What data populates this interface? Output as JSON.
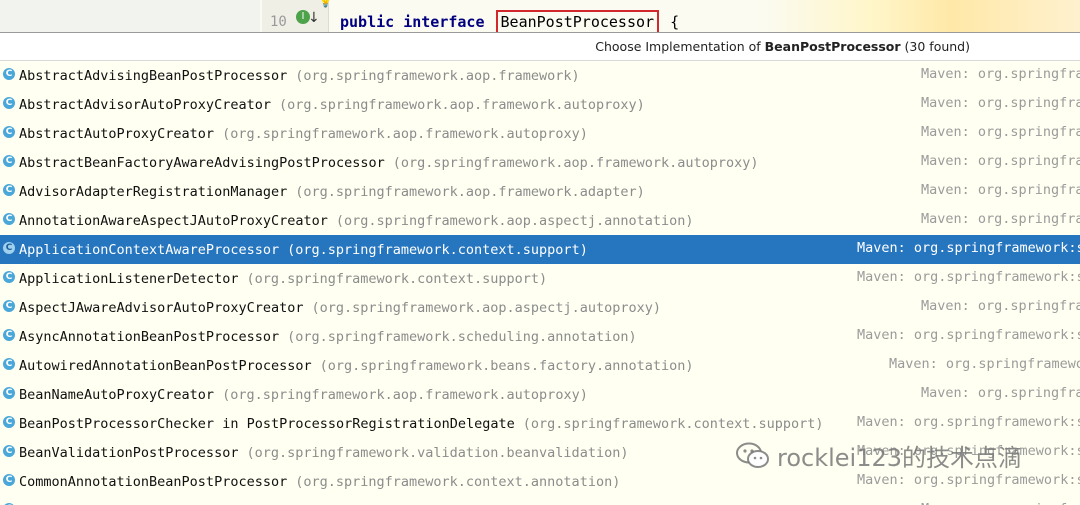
{
  "editor": {
    "line_number": "10",
    "code_keywords": "public interface ",
    "code_identifier": "BeanPostProcessor",
    "code_brace": " {"
  },
  "popup": {
    "header_prefix": "Choose Implementation of ",
    "header_target": "BeanPostProcessor",
    "header_count": " (30 found)",
    "icon_letter": "C",
    "selected_index": 6,
    "rows": [
      {
        "name": "AbstractAdvisingBeanPostProcessor",
        "pkg": "(org.springframework.aop.framework)",
        "source": "Maven: org.springfra"
      },
      {
        "name": "AbstractAdvisorAutoProxyCreator",
        "pkg": "(org.springframework.aop.framework.autoproxy)",
        "source": "Maven: org.springfra"
      },
      {
        "name": "AbstractAutoProxyCreator",
        "pkg": "(org.springframework.aop.framework.autoproxy)",
        "source": "Maven: org.springfra"
      },
      {
        "name": "AbstractBeanFactoryAwareAdvisingPostProcessor",
        "pkg": "(org.springframework.aop.framework.autoproxy)",
        "source": "Maven: org.springfra"
      },
      {
        "name": "AdvisorAdapterRegistrationManager",
        "pkg": "(org.springframework.aop.framework.adapter)",
        "source": "Maven: org.springfra"
      },
      {
        "name": "AnnotationAwareAspectJAutoProxyCreator",
        "pkg": "(org.springframework.aop.aspectj.annotation)",
        "source": "Maven: org.springfra"
      },
      {
        "name": "ApplicationContextAwareProcessor",
        "pkg": "(org.springframework.context.support)",
        "source": "Maven: org.springframework:s"
      },
      {
        "name": "ApplicationListenerDetector",
        "pkg": "(org.springframework.context.support)",
        "source": "Maven: org.springframework:s"
      },
      {
        "name": "AspectJAwareAdvisorAutoProxyCreator",
        "pkg": "(org.springframework.aop.aspectj.autoproxy)",
        "source": "Maven: org.springfra"
      },
      {
        "name": "AsyncAnnotationBeanPostProcessor",
        "pkg": "(org.springframework.scheduling.annotation)",
        "source": "Maven: org.springframework:s"
      },
      {
        "name": "AutowiredAnnotationBeanPostProcessor",
        "pkg": "(org.springframework.beans.factory.annotation)",
        "source": "Maven: org.springframewo"
      },
      {
        "name": "BeanNameAutoProxyCreator",
        "pkg": "(org.springframework.aop.framework.autoproxy)",
        "source": "Maven: org.springfra"
      },
      {
        "name": "BeanPostProcessorChecker in PostProcessorRegistrationDelegate",
        "pkg": "(org.springframework.context.support)",
        "source": "Maven: org.springframework:s"
      },
      {
        "name": "BeanValidationPostProcessor",
        "pkg": "(org.springframework.validation.beanvalidation)",
        "source": "Maven: org.springframework:s"
      },
      {
        "name": "CommonAnnotationBeanPostProcessor",
        "pkg": "(org.springframework.context.annotation)",
        "source": "Maven: org.springframework:s"
      },
      {
        "name": "DefaultAdvisorAutoProxyCreator",
        "pkg": "(org.springframework.aop.framework.autoproxy)",
        "source": "Maven: org.springfra"
      }
    ]
  },
  "watermark": {
    "text": "rocklei123的技术点滴"
  }
}
